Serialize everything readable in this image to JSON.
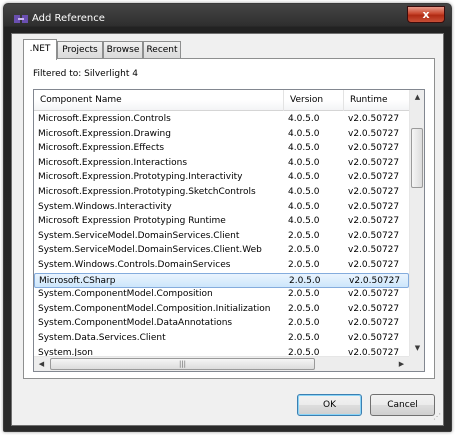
{
  "window": {
    "title": "Add Reference",
    "close_glyph": "x"
  },
  "tabs": [
    ".NET",
    "Projects",
    "Browse",
    "Recent"
  ],
  "filter_label": "Filtered to: Silverlight 4",
  "columns": [
    "Component Name",
    "Version",
    "Runtime"
  ],
  "rows": [
    [
      "Microsoft.Expression.Controls",
      "4.0.5.0",
      "v2.0.50727"
    ],
    [
      "Microsoft.Expression.Drawing",
      "4.0.5.0",
      "v2.0.50727"
    ],
    [
      "Microsoft.Expression.Effects",
      "4.0.5.0",
      "v2.0.50727"
    ],
    [
      "Microsoft.Expression.Interactions",
      "4.0.5.0",
      "v2.0.50727"
    ],
    [
      "Microsoft.Expression.Prototyping.Interactivity",
      "4.0.5.0",
      "v2.0.50727"
    ],
    [
      "Microsoft.Expression.Prototyping.SketchControls",
      "4.0.5.0",
      "v2.0.50727"
    ],
    [
      "System.Windows.Interactivity",
      "4.0.5.0",
      "v2.0.50727"
    ],
    [
      "Microsoft Expression Prototyping Runtime",
      "4.0.5.0",
      "v2.0.50727"
    ],
    [
      "System.ServiceModel.DomainServices.Client",
      "2.0.5.0",
      "v2.0.50727"
    ],
    [
      "System.ServiceModel.DomainServices.Client.Web",
      "2.0.5.0",
      "v2.0.50727"
    ],
    [
      "System.Windows.Controls.DomainServices",
      "2.0.5.0",
      "v2.0.50727"
    ],
    [
      "Microsoft.CSharp",
      "2.0.5.0",
      "v2.0.50727"
    ],
    [
      "System.ComponentModel.Composition",
      "2.0.5.0",
      "v2.0.50727"
    ],
    [
      "System.ComponentModel.Composition.Initialization",
      "2.0.5.0",
      "v2.0.50727"
    ],
    [
      "System.ComponentModel.DataAnnotations",
      "2.0.5.0",
      "v2.0.50727"
    ],
    [
      "System.Data.Services.Client",
      "2.0.5.0",
      "v2.0.50727"
    ],
    [
      "System.Json",
      "2.0.5.0",
      "v2.0.50727"
    ]
  ],
  "selected_row": "Microsoft.CSharp",
  "buttons": {
    "ok": "OK",
    "cancel": "Cancel"
  },
  "icons": {
    "window": "reference-icon",
    "close": "close-icon",
    "scroll_up": "scroll-up-arrow-icon",
    "scroll_down": "scroll-down-arrow-icon",
    "scroll_left": "scroll-left-arrow-icon",
    "scroll_right": "scroll-right-arrow-icon",
    "grip": "resize-grip-icon"
  },
  "colors": {
    "title_bar": "#2e2e2e",
    "close_button": "#c8452d",
    "selection": "#cde6fb",
    "selection_border": "#84acdd",
    "default_button_border": "#3c7fb1"
  }
}
